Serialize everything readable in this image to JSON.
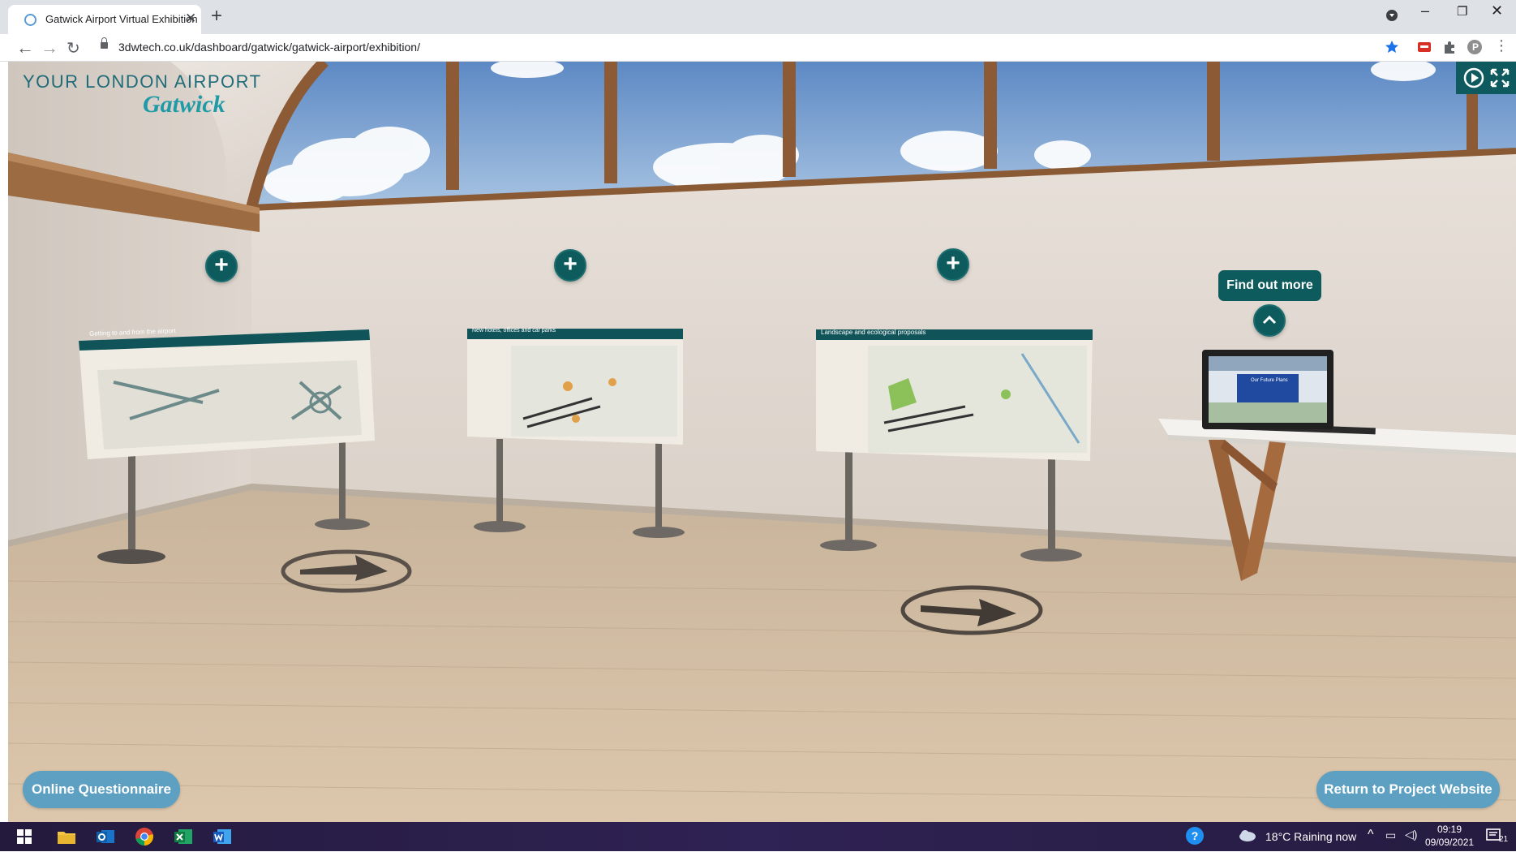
{
  "browser": {
    "tab_title": "Gatwick Airport Virtual Exhibition",
    "url": "3dwtech.co.uk/dashboard/gatwick/gatwick-airport/exhibition/",
    "profile_initial": "P"
  },
  "logo": {
    "line1": "YOUR LONDON AIRPORT",
    "line2": "Gatwick"
  },
  "exhibition": {
    "boards": [
      {
        "title": "Getting to and from the airport"
      },
      {
        "title": "New hotels, offices and car parks"
      },
      {
        "title": "Landscape and ecological proposals"
      }
    ],
    "laptop_screen_title": "Our Future Plans",
    "find_out_more": "Find out more"
  },
  "buttons": {
    "questionnaire": "Online Questionnaire",
    "return": "Return to Project Website"
  },
  "taskbar": {
    "weather": "18°C  Raining now",
    "time": "09:19",
    "date": "09/09/2021",
    "notifications": "21"
  },
  "colors": {
    "accent_teal": "#0e5b5e",
    "pill_blue": "#5da0c2",
    "logo_teal": "#1f9aa6"
  }
}
